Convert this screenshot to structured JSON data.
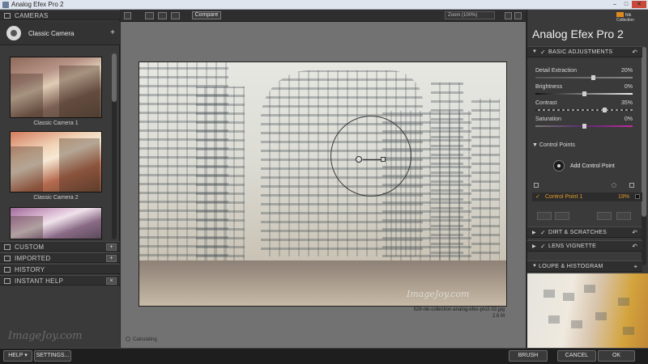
{
  "window": {
    "title": "Analog Efex Pro 2",
    "minimize": "–",
    "maximize": "□",
    "close": "✕"
  },
  "left_panel": {
    "cameras_header": "CAMERAS",
    "preset_name": "Classic Camera",
    "add_symbol": "+",
    "thumbnails": [
      {
        "caption": "Classic Camera 1"
      },
      {
        "caption": "Classic Camera 2"
      },
      {
        "caption": ""
      }
    ],
    "sections": [
      {
        "label": "CUSTOM",
        "button": "+"
      },
      {
        "label": "IMPORTED",
        "button": "+"
      },
      {
        "label": "HISTORY",
        "button": ""
      },
      {
        "label": "INSTANT HELP",
        "button": "×"
      }
    ],
    "watermark": "ImageJoy.com"
  },
  "toolbar": {
    "compare_label": "Compare",
    "zoom_label": "Zoom (100%)"
  },
  "canvas": {
    "filename": "528-nik-collection-analog-efex-pro2-02.jpg",
    "filesize": "2.6 M",
    "status": "Calculating",
    "watermark": "ImageJoy.com"
  },
  "right_panel": {
    "logo_text": "Nik Collection",
    "title": "Analog Efex Pro 2",
    "basic_section": "BASIC ADJUSTMENTS",
    "sliders": [
      {
        "name": "Detail Extraction",
        "value": "20%",
        "level": 0.6
      },
      {
        "name": "Brightness",
        "value": "0%",
        "level": 0.5
      },
      {
        "name": "Contrast",
        "value": "35%",
        "level": 0.72
      },
      {
        "name": "Saturation",
        "value": "0%",
        "level": 0.5
      }
    ],
    "control_points_label": "Control Points",
    "add_control_point": "Add Control Point",
    "control_point": {
      "name": "Control Point 1",
      "value": "19%"
    },
    "dirt_section": "DIRT & SCRATCHES",
    "lens_section": "LENS VIGNETTE",
    "loupe_section": "LOUPE & HISTOGRAM",
    "accent": "#e39a2a"
  },
  "bottom_bar": {
    "help": "HELP ▾",
    "settings": "SETTINGS...",
    "brush": "BRUSH",
    "cancel": "CANCEL",
    "ok": "OK"
  }
}
